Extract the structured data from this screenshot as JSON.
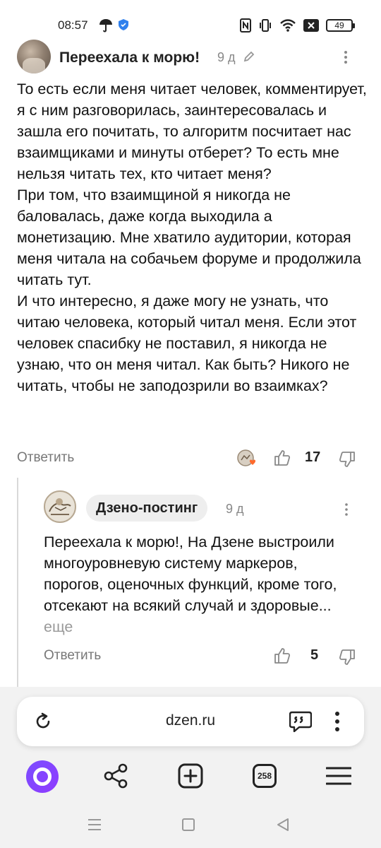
{
  "status_bar": {
    "time": "08:57",
    "battery": "49"
  },
  "comment": {
    "author": "Переехала к морю!",
    "time": "9 д",
    "text": "То есть если меня читает человек, комментирует, я с ним разговорилась, заинтересовалась и зашла его почитать, то алгоритм посчитает нас взаимщиками и минуты отберет? То есть мне нельзя читать тех, кто читает меня?\nПри том, что взаимщиной я никогда не баловалась, даже когда выходила а монетизацию. Мне хватило аудитории, которая меня читала на собачьем форуме и продолжила читать тут.\nИ что интересно, я даже могу не узнать, что читаю человека, который читал меня. Если этот человек спасибку не поставил, я никогда не узнаю, что он меня читал. Как быть? Никого не читать, чтобы не заподозрили во взаимках?",
    "reply_label": "Ответить",
    "likes": "17"
  },
  "reply": {
    "author": "Дзено-постинг",
    "time": "9 д",
    "text": "Переехала к морю!, На Дзене выстроили многоуровневую систему маркеров, порогов, оценочных функций, кроме того, отсекают на всякий случай и здоровые...",
    "more_label": "еще",
    "reply_label": "Ответить",
    "likes": "5"
  },
  "browser": {
    "url": "dzen.ru",
    "tabs_count": "258",
    "accent_color": "#7b4dff"
  }
}
